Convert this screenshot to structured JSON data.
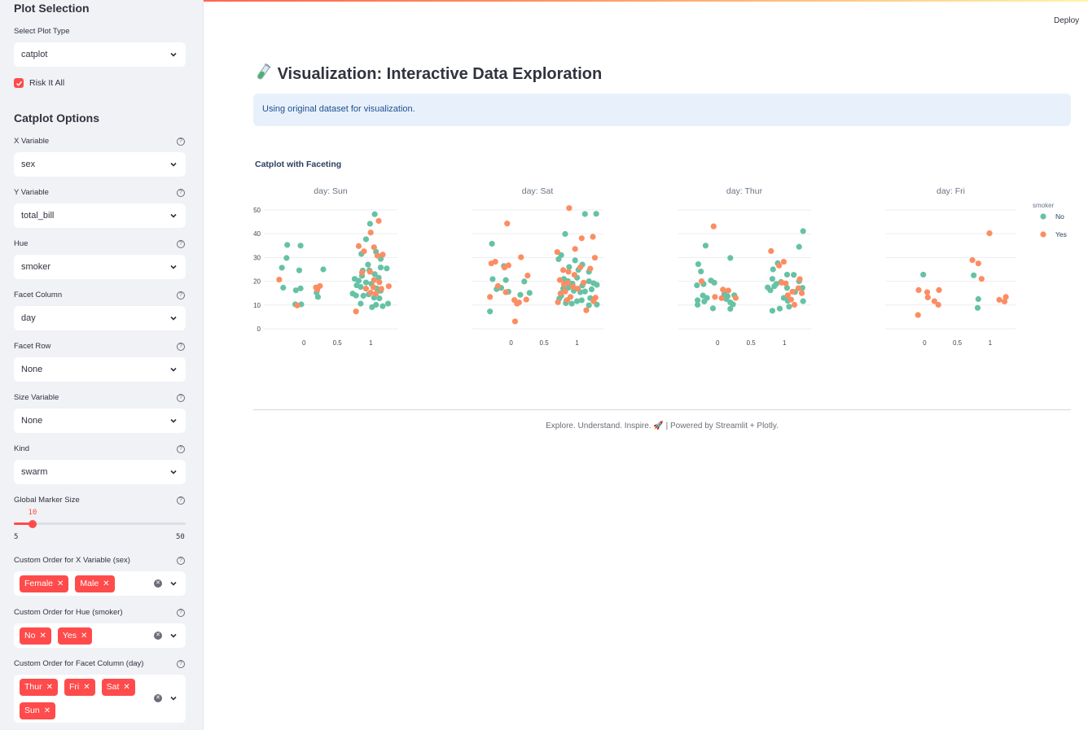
{
  "deploy_label": "Deploy",
  "sidebar": {
    "heading1": "Plot Selection",
    "plot_type": {
      "label": "Select Plot Type",
      "value": "catplot"
    },
    "risk": {
      "label": "Risk It All",
      "checked": true
    },
    "heading2": "Catplot Options",
    "x_var": {
      "label": "X Variable",
      "value": "sex"
    },
    "y_var": {
      "label": "Y Variable",
      "value": "total_bill"
    },
    "hue": {
      "label": "Hue",
      "value": "smoker"
    },
    "facet_col": {
      "label": "Facet Column",
      "value": "day"
    },
    "facet_row": {
      "label": "Facet Row",
      "value": "None"
    },
    "size_var": {
      "label": "Size Variable",
      "value": "None"
    },
    "kind": {
      "label": "Kind",
      "value": "swarm"
    },
    "marker_size": {
      "label": "Global Marker Size",
      "value": "10",
      "min": "5",
      "max": "50",
      "level": 10
    },
    "order_x": {
      "label": "Custom Order for X Variable (sex)",
      "tags": [
        "Female",
        "Male"
      ]
    },
    "order_hue": {
      "label": "Custom Order for Hue (smoker)",
      "tags": [
        "No",
        "Yes"
      ]
    },
    "order_facet": {
      "label": "Custom Order for Facet Column (day)",
      "tags": [
        "Thur",
        "Fri",
        "Sat",
        "Sun"
      ]
    }
  },
  "main": {
    "title": "Visualization: Interactive Data Exploration",
    "info": "Using original dataset for visualization.",
    "footer": "Explore. Understand. Inspire. 🚀 | Powered by Streamlit + Plotly."
  },
  "colors": {
    "no": "#66c2a5",
    "yes": "#fc8d62",
    "accent": "#ff4b4b"
  },
  "chart_data": {
    "type": "scatter",
    "title": "Catplot with Faceting",
    "ylim": [
      0,
      50
    ],
    "yticks": [
      "0",
      "10",
      "20",
      "30",
      "40",
      "50"
    ],
    "xticks": [
      "0",
      "0.5",
      "1"
    ],
    "xlim": [
      -0.6,
      1.4
    ],
    "legend": {
      "title": "smoker",
      "entries": [
        "No",
        "Yes"
      ],
      "placement": "right"
    },
    "facets": [
      {
        "name": "day: Sun",
        "no": [
          [
            -0.25,
            35.3
          ],
          [
            -0.05,
            35.0
          ],
          [
            -0.33,
            25.7
          ],
          [
            -0.07,
            24.6
          ],
          [
            -0.26,
            29.8
          ],
          [
            -0.31,
            17.3
          ],
          [
            -0.12,
            16.2
          ],
          [
            -0.05,
            17.0
          ],
          [
            -0.13,
            10.3
          ],
          [
            -0.04,
            10.3
          ],
          [
            0.19,
            15.2
          ],
          [
            0.21,
            13.4
          ],
          [
            0.29,
            25.0
          ],
          [
            0.86,
            31.5
          ],
          [
            0.96,
            27.0
          ],
          [
            0.93,
            37.7
          ],
          [
            0.99,
            44.2
          ],
          [
            1.06,
            48.2
          ],
          [
            1.08,
            32.4
          ],
          [
            1.15,
            29.4
          ],
          [
            0.88,
            24.5
          ],
          [
            0.98,
            24.6
          ],
          [
            1.15,
            25.8
          ],
          [
            0.76,
            21.0
          ],
          [
            0.82,
            20.2
          ],
          [
            0.87,
            22.3
          ],
          [
            0.79,
            18.3
          ],
          [
            0.85,
            17.6
          ],
          [
            0.93,
            19.5
          ],
          [
            1.01,
            18.9
          ],
          [
            1.09,
            17.0
          ],
          [
            1.15,
            16.0
          ],
          [
            0.73,
            14.8
          ],
          [
            0.78,
            14.0
          ],
          [
            0.89,
            13.9
          ],
          [
            0.97,
            14.5
          ],
          [
            1.05,
            13.1
          ],
          [
            1.13,
            12.8
          ],
          [
            0.85,
            10.6
          ],
          [
            1.02,
            9.1
          ],
          [
            1.08,
            10.1
          ],
          [
            1.18,
            9.5
          ],
          [
            1.26,
            10.6
          ],
          [
            1.24,
            25.4
          ],
          [
            1.06,
            23.0
          ],
          [
            1.12,
            21.5
          ]
        ],
        "yes": [
          [
            -0.37,
            20.7
          ],
          [
            -0.1,
            9.8
          ],
          [
            0.18,
            17.4
          ],
          [
            0.2,
            16.5
          ],
          [
            0.24,
            18.0
          ],
          [
            0.82,
            34.8
          ],
          [
            0.9,
            32.6
          ],
          [
            1.0,
            40.5
          ],
          [
            1.05,
            34.3
          ],
          [
            1.12,
            45.4
          ],
          [
            1.1,
            30.8
          ],
          [
            1.18,
            31.2
          ],
          [
            0.87,
            23.7
          ],
          [
            0.99,
            24.0
          ],
          [
            1.05,
            20.5
          ],
          [
            1.13,
            19.6
          ],
          [
            0.93,
            16.9
          ],
          [
            1.0,
            15.2
          ],
          [
            1.08,
            14.8
          ],
          [
            1.16,
            16.8
          ],
          [
            1.27,
            17.9
          ],
          [
            0.78,
            7.3
          ],
          [
            1.04,
            17.5
          ]
        ]
      },
      {
        "name": "day: Sat",
        "no": [
          [
            -0.29,
            35.8
          ],
          [
            -0.28,
            20.9
          ],
          [
            -0.32,
            7.3
          ],
          [
            -0.11,
            26.4
          ],
          [
            -0.04,
            15.6
          ],
          [
            -0.22,
            16.7
          ],
          [
            -0.08,
            20.5
          ],
          [
            -0.15,
            17.2
          ],
          [
            0.14,
            14.3
          ],
          [
            0.28,
            15.1
          ],
          [
            0.2,
            19.9
          ],
          [
            0.82,
            39.9
          ],
          [
            0.97,
            28.8
          ],
          [
            1.12,
            48.3
          ],
          [
            1.29,
            48.4
          ],
          [
            0.76,
            31.0
          ],
          [
            0.72,
            29.3
          ],
          [
            0.88,
            26.0
          ],
          [
            1.02,
            24.8
          ],
          [
            1.18,
            24.0
          ],
          [
            0.8,
            21.0
          ],
          [
            0.86,
            20.1
          ],
          [
            0.93,
            19.0
          ],
          [
            1.0,
            21.5
          ],
          [
            1.08,
            18.2
          ],
          [
            1.18,
            20.0
          ],
          [
            1.25,
            19.2
          ],
          [
            1.3,
            18.5
          ],
          [
            0.79,
            16.9
          ],
          [
            0.87,
            17.3
          ],
          [
            0.95,
            16.0
          ],
          [
            1.05,
            15.4
          ],
          [
            1.12,
            15.7
          ],
          [
            1.22,
            16.6
          ],
          [
            0.76,
            13.9
          ],
          [
            0.84,
            11.9
          ],
          [
            0.92,
            10.6
          ],
          [
            1.0,
            11.6
          ],
          [
            1.07,
            12.0
          ],
          [
            1.2,
            12.9
          ],
          [
            1.3,
            10.2
          ],
          [
            0.73,
            12.7
          ],
          [
            0.83,
            10.8
          ],
          [
            1.18,
            9.9
          ],
          [
            1.08,
            27.0
          ]
        ],
        "yes": [
          [
            -0.06,
            44.3
          ],
          [
            -0.3,
            27.5
          ],
          [
            -0.24,
            28.2
          ],
          [
            -0.1,
            25.8
          ],
          [
            -0.04,
            26.7
          ],
          [
            0.15,
            30.1
          ],
          [
            0.25,
            22.4
          ],
          [
            -0.2,
            18.0
          ],
          [
            -0.08,
            15.4
          ],
          [
            0.05,
            12.1
          ],
          [
            0.12,
            11.1
          ],
          [
            0.09,
            10.6
          ],
          [
            0.23,
            12.3
          ],
          [
            -0.32,
            13.4
          ],
          [
            0.06,
            3.1
          ],
          [
            0.88,
            50.8
          ],
          [
            1.07,
            38.1
          ],
          [
            1.24,
            38.7
          ],
          [
            0.97,
            33.6
          ],
          [
            0.7,
            32.3
          ],
          [
            1.05,
            25.9
          ],
          [
            1.2,
            25.3
          ],
          [
            1.27,
            29.9
          ],
          [
            0.79,
            24.7
          ],
          [
            0.87,
            24.0
          ],
          [
            0.96,
            22.7
          ],
          [
            0.74,
            20.5
          ],
          [
            0.8,
            18.7
          ],
          [
            0.86,
            19.3
          ],
          [
            0.94,
            17.7
          ],
          [
            1.01,
            16.9
          ],
          [
            1.1,
            19.4
          ],
          [
            1.28,
            13.1
          ],
          [
            0.75,
            14.9
          ],
          [
            0.82,
            15.7
          ],
          [
            0.9,
            13.4
          ],
          [
            0.71,
            11.2
          ],
          [
            1.14,
            7.8
          ],
          [
            1.25,
            11.6
          ],
          [
            0.85,
            12.1
          ]
        ]
      },
      {
        "name": "day: Thur",
        "no": [
          [
            -0.29,
            27.2
          ],
          [
            -0.25,
            24.1
          ],
          [
            -0.18,
            35.0
          ],
          [
            0.19,
            29.8
          ],
          [
            -0.31,
            18.3
          ],
          [
            -0.21,
            18.8
          ],
          [
            -0.1,
            20.3
          ],
          [
            -0.05,
            19.4
          ],
          [
            -0.22,
            14.0
          ],
          [
            -0.16,
            13.0
          ],
          [
            -0.3,
            12.0
          ],
          [
            -0.2,
            11.5
          ],
          [
            -0.3,
            10.1
          ],
          [
            -0.07,
            8.6
          ],
          [
            0.13,
            12.5
          ],
          [
            0.19,
            11.1
          ],
          [
            0.23,
            10.3
          ],
          [
            0.1,
            14.5
          ],
          [
            0.15,
            13.7
          ],
          [
            0.25,
            14.1
          ],
          [
            0.19,
            8.4
          ],
          [
            0.83,
            25.0
          ],
          [
            0.9,
            27.6
          ],
          [
            1.04,
            22.8
          ],
          [
            1.22,
            34.5
          ],
          [
            1.28,
            41.1
          ],
          [
            0.82,
            21.0
          ],
          [
            0.88,
            18.9
          ],
          [
            0.95,
            19.7
          ],
          [
            1.04,
            17.2
          ],
          [
            1.14,
            22.7
          ],
          [
            1.22,
            20.0
          ],
          [
            0.75,
            17.4
          ],
          [
            0.79,
            16.2
          ],
          [
            0.85,
            17.9
          ],
          [
            0.99,
            13.0
          ],
          [
            1.05,
            11.8
          ],
          [
            1.16,
            15.5
          ],
          [
            1.27,
            17.2
          ],
          [
            1.28,
            11.6
          ],
          [
            0.82,
            7.6
          ],
          [
            0.93,
            8.5
          ],
          [
            1.07,
            9.3
          ]
        ],
        "yes": [
          [
            -0.06,
            43.1
          ],
          [
            -0.24,
            20.0
          ],
          [
            0.08,
            16.5
          ],
          [
            0.16,
            16.1
          ],
          [
            -0.04,
            13.4
          ],
          [
            0.06,
            12.9
          ],
          [
            0.27,
            13.0
          ],
          [
            0.8,
            32.7
          ],
          [
            0.99,
            28.2
          ],
          [
            0.92,
            26.6
          ],
          [
            0.96,
            19.4
          ],
          [
            1.02,
            19.1
          ],
          [
            1.12,
            15.6
          ],
          [
            1.21,
            17.1
          ],
          [
            1.05,
            14.1
          ],
          [
            1.1,
            12.3
          ],
          [
            1.15,
            10.1
          ],
          [
            1.26,
            15.0
          ],
          [
            1.23,
            20.9
          ]
        ]
      },
      {
        "name": "day: Fri",
        "no": [
          [
            -0.02,
            22.8
          ],
          [
            0.75,
            22.5
          ],
          [
            0.82,
            12.5
          ],
          [
            0.81,
            8.8
          ]
        ],
        "yes": [
          [
            -0.09,
            16.3
          ],
          [
            -0.1,
            5.8
          ],
          [
            0.04,
            15.4
          ],
          [
            0.05,
            13.2
          ],
          [
            0.15,
            11.6
          ],
          [
            0.21,
            10.1
          ],
          [
            0.22,
            16.3
          ],
          [
            0.73,
            28.9
          ],
          [
            0.82,
            27.5
          ],
          [
            0.87,
            21.0
          ],
          [
            0.99,
            40.2
          ],
          [
            1.14,
            12.2
          ],
          [
            1.22,
            11.5
          ],
          [
            1.24,
            13.4
          ]
        ]
      }
    ]
  }
}
